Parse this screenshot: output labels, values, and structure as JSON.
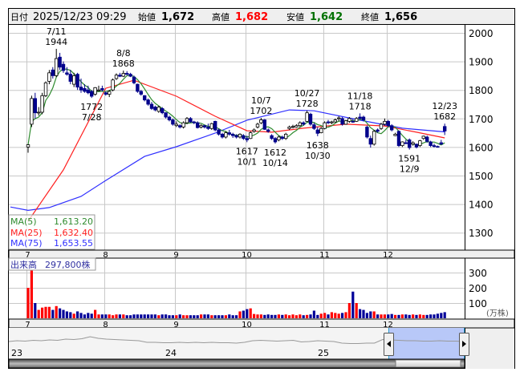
{
  "header": {
    "date_label": "日付",
    "datetime": "2025/12/23 09:29",
    "open_label": "始値",
    "open": "1,672",
    "high_label": "高値",
    "high": "1,682",
    "low_label": "安値",
    "low": "1,642",
    "close_label": "終値",
    "close": "1,656"
  },
  "legend": {
    "ma5_label": "MA(5)",
    "ma5_value": "1,613.20",
    "ma25_label": "MA(25)",
    "ma25_value": "1,632.40",
    "ma75_label": "MA(75)",
    "ma75_value": "1,653.55"
  },
  "volume_legend": {
    "label": "出来高",
    "value": "297,800株"
  },
  "colors": {
    "up_fill": "#ffffff",
    "up_stroke": "#000000",
    "down": "#00008b",
    "ma5": "#2e8b2e",
    "ma25": "#ff2020",
    "ma75": "#3030ff",
    "vol_up": "#ff0000",
    "vol_down": "#000099",
    "grid": "#c8c8c8",
    "high_text": "#ff0000",
    "low_text": "#007000"
  },
  "chart_data": {
    "type": "candlestick",
    "price_axis": {
      "ticks": [
        "2000",
        "1900",
        "1800",
        "1700",
        "1600",
        "1500",
        "1400",
        "1300"
      ],
      "range": [
        1270,
        2030
      ]
    },
    "month_labels": [
      {
        "label": "7",
        "index": 0
      },
      {
        "label": "8",
        "index": 22
      },
      {
        "label": "9",
        "index": 42
      },
      {
        "label": "10",
        "index": 62
      },
      {
        "label": "11",
        "index": 84
      },
      {
        "label": "12",
        "index": 102
      }
    ],
    "ohlc": [
      [
        1600,
        1610,
        1580,
        1608
      ],
      [
        1680,
        1780,
        1670,
        1770
      ],
      [
        1770,
        1790,
        1700,
        1720
      ],
      [
        1720,
        1740,
        1710,
        1722
      ],
      [
        1722,
        1790,
        1715,
        1780
      ],
      [
        1780,
        1830,
        1775,
        1825
      ],
      [
        1830,
        1870,
        1820,
        1860
      ],
      [
        1870,
        1880,
        1840,
        1850
      ],
      [
        1850,
        1944,
        1845,
        1910
      ],
      [
        1915,
        1930,
        1870,
        1880
      ],
      [
        1890,
        1900,
        1860,
        1868
      ],
      [
        1860,
        1880,
        1850,
        1855
      ],
      [
        1855,
        1870,
        1820,
        1830
      ],
      [
        1820,
        1860,
        1810,
        1850
      ],
      [
        1855,
        1860,
        1800,
        1810
      ],
      [
        1810,
        1840,
        1790,
        1800
      ],
      [
        1805,
        1820,
        1790,
        1795
      ],
      [
        1800,
        1815,
        1785,
        1790
      ],
      [
        1795,
        1800,
        1772,
        1778
      ],
      [
        1785,
        1810,
        1780,
        1808
      ],
      [
        1800,
        1815,
        1795,
        1800
      ],
      [
        1805,
        1815,
        1795,
        1800
      ],
      [
        1790,
        1795,
        1780,
        1785
      ],
      [
        1785,
        1800,
        1775,
        1795
      ],
      [
        1800,
        1840,
        1795,
        1835
      ],
      [
        1840,
        1858,
        1835,
        1852
      ],
      [
        1852,
        1860,
        1845,
        1848
      ],
      [
        1848,
        1868,
        1845,
        1858
      ],
      [
        1858,
        1866,
        1850,
        1855
      ],
      [
        1855,
        1860,
        1845,
        1848
      ],
      [
        1845,
        1850,
        1820,
        1825
      ],
      [
        1820,
        1822,
        1790,
        1795
      ],
      [
        1795,
        1800,
        1780,
        1785
      ],
      [
        1780,
        1782,
        1760,
        1765
      ],
      [
        1765,
        1770,
        1745,
        1750
      ],
      [
        1750,
        1758,
        1730,
        1735
      ],
      [
        1740,
        1745,
        1725,
        1730
      ],
      [
        1725,
        1745,
        1720,
        1740
      ],
      [
        1735,
        1740,
        1715,
        1720
      ],
      [
        1720,
        1722,
        1700,
        1705
      ],
      [
        1705,
        1710,
        1690,
        1695
      ],
      [
        1695,
        1700,
        1675,
        1680
      ],
      [
        1675,
        1690,
        1670,
        1680
      ],
      [
        1675,
        1680,
        1665,
        1670
      ],
      [
        1670,
        1690,
        1665,
        1685
      ],
      [
        1685,
        1705,
        1680,
        1700
      ],
      [
        1700,
        1705,
        1685,
        1688
      ],
      [
        1688,
        1692,
        1680,
        1685
      ],
      [
        1685,
        1690,
        1665,
        1668
      ],
      [
        1670,
        1680,
        1665,
        1675
      ],
      [
        1675,
        1678,
        1665,
        1670
      ],
      [
        1670,
        1682,
        1660,
        1665
      ],
      [
        1665,
        1685,
        1660,
        1682
      ],
      [
        1690,
        1692,
        1655,
        1660
      ],
      [
        1660,
        1665,
        1640,
        1645
      ],
      [
        1645,
        1650,
        1630,
        1635
      ],
      [
        1635,
        1655,
        1630,
        1650
      ],
      [
        1650,
        1660,
        1640,
        1645
      ],
      [
        1645,
        1650,
        1632,
        1640
      ],
      [
        1640,
        1645,
        1630,
        1635
      ],
      [
        1635,
        1648,
        1630,
        1645
      ],
      [
        1640,
        1645,
        1625,
        1630
      ],
      [
        1630,
        1640,
        1617,
        1625
      ],
      [
        1630,
        1655,
        1628,
        1650
      ],
      [
        1655,
        1665,
        1650,
        1660
      ],
      [
        1670,
        1685,
        1665,
        1680
      ],
      [
        1685,
        1702,
        1680,
        1695
      ],
      [
        1695,
        1698,
        1660,
        1662
      ],
      [
        1660,
        1665,
        1650,
        1655
      ],
      [
        1640,
        1645,
        1625,
        1630
      ],
      [
        1630,
        1635,
        1612,
        1618
      ],
      [
        1625,
        1640,
        1620,
        1635
      ],
      [
        1635,
        1640,
        1625,
        1630
      ],
      [
        1630,
        1650,
        1625,
        1645
      ],
      [
        1665,
        1675,
        1660,
        1670
      ],
      [
        1670,
        1678,
        1665,
        1672
      ],
      [
        1670,
        1680,
        1668,
        1675
      ],
      [
        1675,
        1690,
        1670,
        1685
      ],
      [
        1685,
        1690,
        1675,
        1680
      ],
      [
        1690,
        1728,
        1688,
        1720
      ],
      [
        1715,
        1720,
        1675,
        1680
      ],
      [
        1678,
        1685,
        1660,
        1665
      ],
      [
        1660,
        1670,
        1638,
        1648
      ],
      [
        1650,
        1670,
        1648,
        1665
      ],
      [
        1665,
        1690,
        1662,
        1685
      ],
      [
        1688,
        1695,
        1680,
        1685
      ],
      [
        1685,
        1692,
        1680,
        1688
      ],
      [
        1688,
        1700,
        1685,
        1695
      ],
      [
        1700,
        1708,
        1690,
        1702
      ],
      [
        1700,
        1705,
        1675,
        1680
      ],
      [
        1680,
        1695,
        1678,
        1692
      ],
      [
        1690,
        1705,
        1685,
        1700
      ],
      [
        1690,
        1700,
        1685,
        1688
      ],
      [
        1690,
        1705,
        1688,
        1700
      ],
      [
        1705,
        1718,
        1695,
        1700
      ],
      [
        1705,
        1710,
        1690,
        1695
      ],
      [
        1670,
        1675,
        1630,
        1635
      ],
      [
        1630,
        1640,
        1598,
        1610
      ],
      [
        1610,
        1660,
        1605,
        1655
      ],
      [
        1660,
        1665,
        1650,
        1655
      ],
      [
        1665,
        1685,
        1660,
        1680
      ],
      [
        1680,
        1700,
        1675,
        1690
      ],
      [
        1690,
        1695,
        1670,
        1675
      ],
      [
        1675,
        1680,
        1655,
        1660
      ],
      [
        1640,
        1650,
        1638,
        1645
      ],
      [
        1655,
        1658,
        1600,
        1605
      ],
      [
        1605,
        1620,
        1600,
        1618
      ],
      [
        1615,
        1625,
        1610,
        1612
      ],
      [
        1625,
        1630,
        1591,
        1598
      ],
      [
        1610,
        1620,
        1605,
        1615
      ],
      [
        1610,
        1612,
        1595,
        1600
      ],
      [
        1605,
        1625,
        1600,
        1622
      ],
      [
        1630,
        1640,
        1625,
        1638
      ],
      [
        1635,
        1640,
        1615,
        1620
      ],
      [
        1618,
        1622,
        1600,
        1605
      ],
      [
        1605,
        1612,
        1598,
        1602
      ],
      [
        1602,
        1605,
        1598,
        1600
      ],
      [
        1615,
        1625,
        1608,
        1610
      ],
      [
        1672,
        1682,
        1642,
        1656
      ]
    ],
    "ma25_points": [
      [
        0,
        1340
      ],
      [
        10,
        1520
      ],
      [
        22,
        1806
      ],
      [
        30,
        1834
      ],
      [
        42,
        1778
      ],
      [
        53,
        1708
      ],
      [
        62,
        1657
      ],
      [
        69,
        1652
      ],
      [
        78,
        1666
      ],
      [
        90,
        1680
      ],
      [
        101,
        1674
      ],
      [
        110,
        1652
      ],
      [
        118,
        1632
      ]
    ],
    "ma75_points": [
      [
        -5,
        1390
      ],
      [
        0,
        1378
      ],
      [
        6,
        1388
      ],
      [
        15,
        1427
      ],
      [
        22,
        1483
      ],
      [
        33,
        1567
      ],
      [
        42,
        1601
      ],
      [
        53,
        1649
      ],
      [
        62,
        1694
      ],
      [
        74,
        1730
      ],
      [
        81,
        1727
      ],
      [
        94,
        1694
      ],
      [
        106,
        1666
      ],
      [
        118,
        1653
      ]
    ],
    "annotations": [
      {
        "date": "7/11",
        "value": "1944",
        "index": 8,
        "position": "above"
      },
      {
        "date": "7/28",
        "value": "1772",
        "index": 18,
        "position": "below"
      },
      {
        "date": "8/8",
        "value": "1868",
        "index": 27,
        "position": "above"
      },
      {
        "date": "10/1",
        "value": "1617",
        "index": 62,
        "position": "below"
      },
      {
        "date": "10/7",
        "value": "1702",
        "index": 66,
        "position": "above"
      },
      {
        "date": "10/14",
        "value": "1612",
        "index": 70,
        "position": "below"
      },
      {
        "date": "10/27",
        "value": "1728",
        "index": 79,
        "position": "above"
      },
      {
        "date": "10/30",
        "value": "1638",
        "index": 82,
        "position": "below"
      },
      {
        "date": "11/18",
        "value": "1718",
        "index": 94,
        "position": "above"
      },
      {
        "date": "12/9",
        "value": "1591",
        "index": 108,
        "position": "below"
      },
      {
        "date": "12/23",
        "value": "1682",
        "index": 118,
        "position": "above"
      }
    ],
    "volume": {
      "unit": "(万株)",
      "ticks": [
        "300",
        "200",
        "100"
      ],
      "values": [
        200,
        380,
        100,
        55,
        70,
        75,
        75,
        55,
        80,
        65,
        55,
        45,
        40,
        30,
        45,
        35,
        25,
        35,
        30,
        55,
        25,
        25,
        25,
        25,
        20,
        25,
        25,
        25,
        20,
        20,
        25,
        25,
        25,
        25,
        25,
        25,
        25,
        20,
        25,
        25,
        20,
        20,
        20,
        25,
        20,
        20,
        20,
        20,
        20,
        25,
        25,
        25,
        20,
        20,
        20,
        20,
        20,
        25,
        20,
        20,
        45,
        50,
        60,
        65,
        28,
        25,
        25,
        22,
        25,
        22,
        22,
        25,
        22,
        25,
        20,
        25,
        20,
        25,
        20,
        22,
        25,
        50,
        22,
        30,
        35,
        25,
        40,
        35,
        30,
        35,
        40,
        100,
        175,
        100,
        60,
        55,
        35,
        45,
        45,
        25,
        25,
        25,
        25,
        28,
        22,
        22,
        25,
        25,
        22,
        25,
        22,
        25,
        22,
        22,
        25,
        25,
        30,
        35,
        40
      ]
    }
  },
  "navigator": {
    "year_labels": [
      "23",
      "24",
      "25"
    ],
    "series": [
      40,
      42,
      41,
      43,
      42,
      44,
      43,
      46,
      45,
      47,
      52,
      48,
      46,
      45,
      44,
      43,
      42,
      38,
      38,
      37,
      37,
      38,
      37,
      38,
      37,
      38,
      37,
      37,
      36,
      38,
      42,
      43,
      42,
      41,
      42,
      43,
      39,
      40,
      42,
      41,
      40,
      36,
      35,
      35,
      36,
      36,
      45,
      44,
      43,
      42,
      42,
      41,
      41,
      42,
      41,
      41,
      40
    ]
  }
}
